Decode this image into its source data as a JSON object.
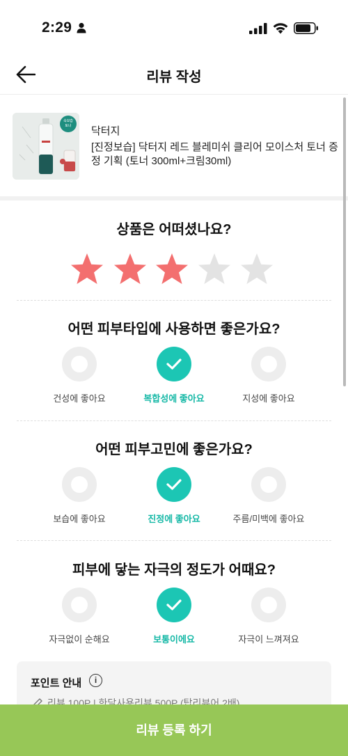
{
  "status_bar": {
    "time": "2:29"
  },
  "header": {
    "title": "리뷰 작성"
  },
  "product": {
    "brand": "닥터지",
    "name": "[진정보습] 닥터지 레드 블레미쉬 클리어 모이스처 토너 증정 기획 (토너 300ml+크림30ml)",
    "badge_text": [
      "속보습",
      "토너"
    ]
  },
  "rating": {
    "question": "상품은 어떠셨나요?",
    "value": 3,
    "max": 5,
    "filled_color": "#f36f6f",
    "empty_color": "#e3e3e3"
  },
  "skin_type": {
    "question": "어떤 피부타입에 사용하면 좋은가요?",
    "options": [
      "건성에 좋아요",
      "복합성에 좋아요",
      "지성에 좋아요"
    ],
    "selected": 1
  },
  "skin_concern": {
    "question": "어떤 피부고민에 좋은가요?",
    "options": [
      "보습에 좋아요",
      "진정에 좋아요",
      "주름/미백에 좋아요"
    ],
    "selected": 1
  },
  "irritation": {
    "question": "피부에 닿는 자극의 정도가 어때요?",
    "options": [
      "자극없이 순해요",
      "보통이에요",
      "자극이 느껴져요"
    ],
    "selected": 1
  },
  "point_info": {
    "title": "포인트 안내",
    "line": "리뷰 100P | 한달사용리뷰 500P (탑리뷰어 2배)"
  },
  "submit": {
    "label": "리뷰 등록 하기"
  },
  "colors": {
    "accent_teal": "#1cc6b4",
    "submit_green": "#97c757"
  }
}
